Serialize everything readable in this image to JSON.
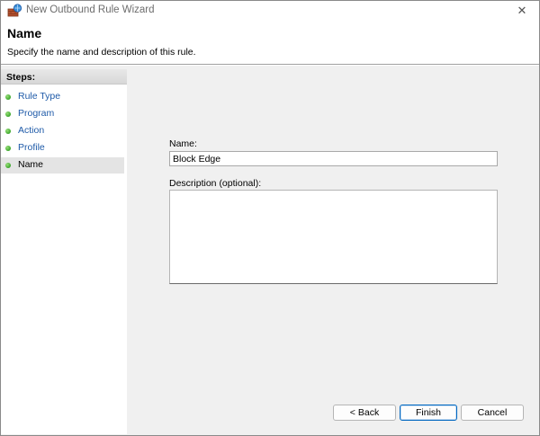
{
  "window": {
    "title": "New Outbound Rule Wizard",
    "close_glyph": "✕"
  },
  "header": {
    "title": "Name",
    "subtitle": "Specify the name and description of this rule."
  },
  "steps": {
    "heading": "Steps:",
    "items": [
      {
        "label": "Rule Type"
      },
      {
        "label": "Program"
      },
      {
        "label": "Action"
      },
      {
        "label": "Profile"
      },
      {
        "label": "Name"
      }
    ],
    "active_index": 4
  },
  "form": {
    "name_label": "Name:",
    "name_value": "Block Edge",
    "description_label": "Description (optional):",
    "description_value": ""
  },
  "buttons": {
    "back": "< Back",
    "finish": "Finish",
    "cancel": "Cancel"
  },
  "icons": {
    "title": "firewall-wizard-icon",
    "close": "close-icon",
    "step_bullet": "green-bullet-icon"
  },
  "colors": {
    "link_blue": "#1e5aa8",
    "bullet_green": "#3aa52a",
    "default_button_border": "#0067c0"
  }
}
